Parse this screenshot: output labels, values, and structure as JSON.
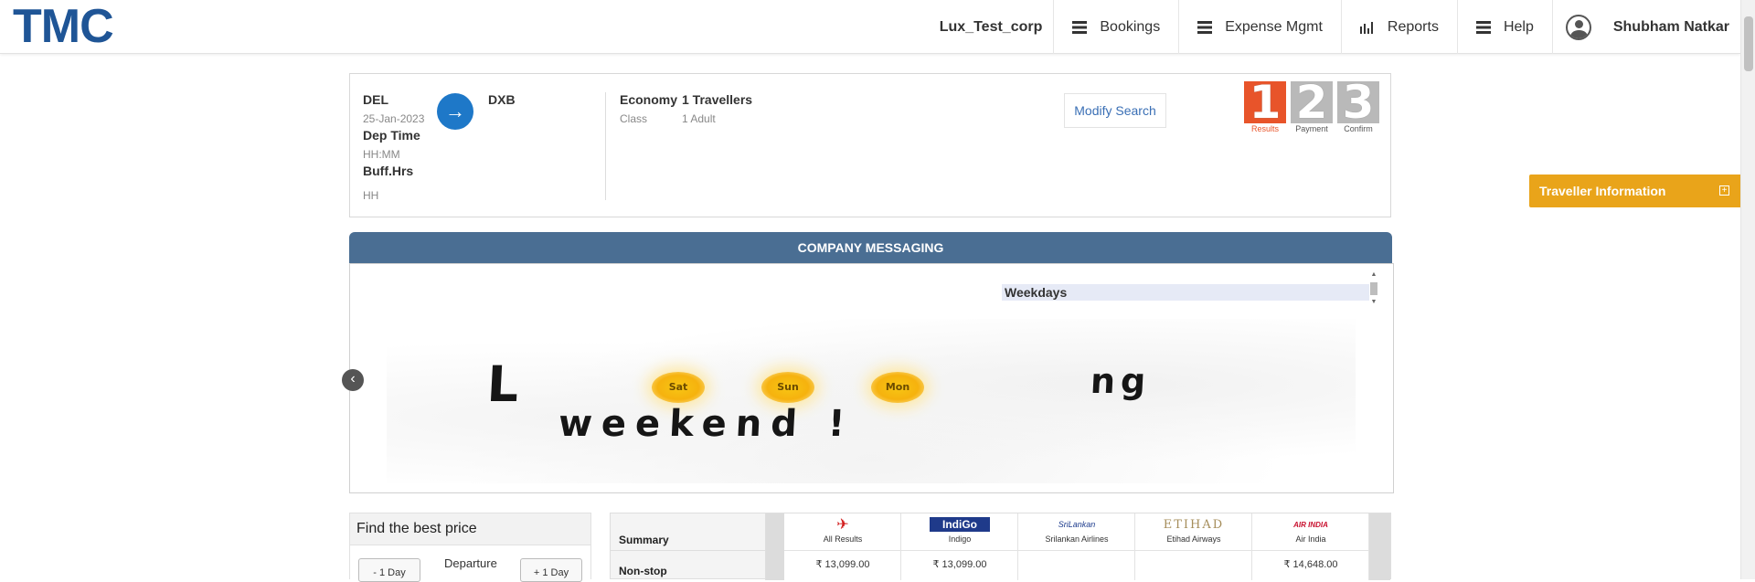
{
  "header": {
    "logo": "TMC",
    "corp_name": "Lux_Test_corp",
    "nav": [
      {
        "label": "Bookings",
        "icon": "menu-icon"
      },
      {
        "label": "Expense Mgmt",
        "icon": "menu-icon"
      },
      {
        "label": "Reports",
        "icon": "bar-chart-icon"
      },
      {
        "label": "Help",
        "icon": "menu-icon"
      }
    ],
    "user_name": "Shubham Natkar"
  },
  "search": {
    "from_code": "DEL",
    "date": "25-Jan-2023",
    "dep_time_label": "Dep Time",
    "dep_time_value": "HH:MM",
    "buff_label": "Buff.Hrs",
    "buff_value": "HH",
    "to_code": "DXB",
    "cabin": "Economy",
    "cabin_label": "Class",
    "travellers": "1 Travellers",
    "travellers_sub": "1 Adult",
    "modify_label": "Modify Search"
  },
  "steps": [
    {
      "num": "1",
      "label": "Results",
      "active": true
    },
    {
      "num": "2",
      "label": "Payment",
      "active": false
    },
    {
      "num": "3",
      "label": "Confirm",
      "active": false
    }
  ],
  "traveller_info": {
    "label": "Traveller Information",
    "toggle": "+"
  },
  "messaging": {
    "title": "COMPANY MESSAGING",
    "list_item": "Weekdays",
    "banner_line1_start": "L",
    "banner_line1_end": "ng",
    "banner_suns": [
      "Sat",
      "Sun",
      "Mon"
    ],
    "banner_line2": "weekend !"
  },
  "best_price": {
    "title": "Find the best price",
    "minus_day": "- 1 Day",
    "departure": "Departure",
    "plus_day": "+ 1 Day"
  },
  "summary": {
    "row_summary": "Summary",
    "row_nonstop": "Non-stop",
    "columns": [
      {
        "airline": "All Results",
        "price": "₹ 13,099.00",
        "logo": "✈"
      },
      {
        "airline": "Indigo",
        "price": "₹ 13,099.00",
        "logo": "IndiGo"
      },
      {
        "airline": "Srilankan Airlines",
        "price": "",
        "logo": "SriLankan"
      },
      {
        "airline": "Etihad Airways",
        "price": "",
        "logo": "ETIHAD"
      },
      {
        "airline": "Air India",
        "price": "₹ 14,648.00",
        "logo": "AIR INDIA"
      }
    ]
  },
  "colors": {
    "brand": "#1f5596",
    "header_bar": "#4a6e93",
    "traveller_bar": "#e9a41a",
    "step_active": "#e8542a"
  }
}
